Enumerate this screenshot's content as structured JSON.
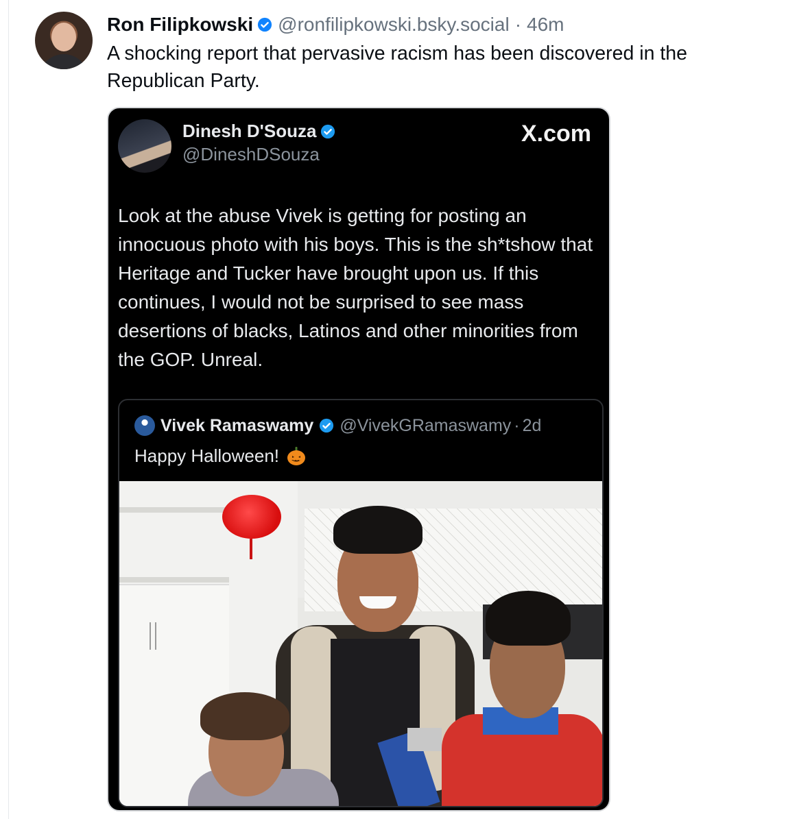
{
  "post": {
    "author_name": "Ron Filipkowski",
    "author_handle": "@ronfilipkowski.bsky.social",
    "separator": "·",
    "time": "46m",
    "text": "A shocking report that pervasive racism has been discovered in the Republican Party."
  },
  "embed": {
    "author_name": "Dinesh D'Souza",
    "author_handle": "@DineshDSouza",
    "source": "X.com",
    "text": "Look at the abuse Vivek is getting for posting an innocuous photo with his boys. This is the sh*tshow that Heritage and Tucker have brought upon us. If this continues, I would not be surprised to see mass desertions of blacks, Latinos and other minorities from the GOP. Unreal.",
    "quote": {
      "author_name": "Vivek Ramaswamy",
      "author_handle": "@VivekGRamaswamy",
      "separator": "·",
      "time": "2d",
      "text": "Happy Halloween!"
    }
  },
  "colors": {
    "verified": "#1d9bf0",
    "bsky_verified": "#1083fe",
    "embed_bg": "#000000",
    "text_primary": "#0b0f14",
    "text_muted": "#66717d"
  },
  "icons": [
    "verified-badge-icon",
    "pumpkin-emoji-icon",
    "x-logo"
  ]
}
